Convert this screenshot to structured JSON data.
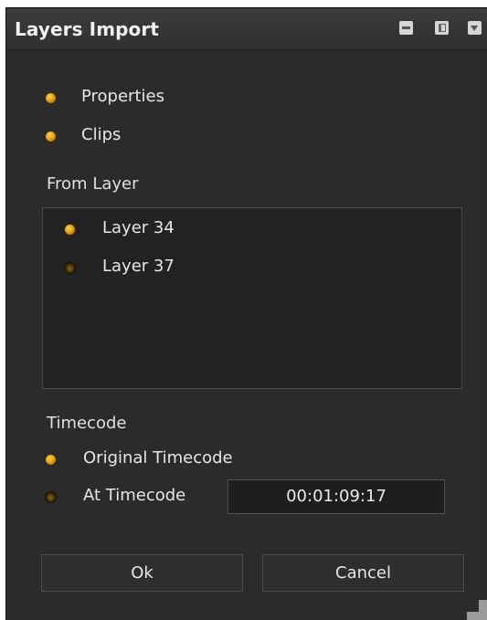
{
  "window": {
    "title": "Layers Import"
  },
  "import_options": [
    {
      "label": "Properties",
      "selected": true
    },
    {
      "label": "Clips",
      "selected": true
    }
  ],
  "from_layer": {
    "heading": "From Layer",
    "layers": [
      {
        "label": "Layer 34",
        "selected": true
      },
      {
        "label": "Layer 37",
        "selected": false
      }
    ]
  },
  "timecode": {
    "heading": "Timecode",
    "original_label": "Original Timecode",
    "original_selected": true,
    "at_label": "At Timecode",
    "at_selected": false,
    "value": "00:01:09:17"
  },
  "buttons": {
    "ok_label": "Ok",
    "cancel_label": "Cancel"
  },
  "colors": {
    "panel_bg": "#2b2b2b",
    "radio_on": "#e0a21a",
    "radio_off": "#3b2a08",
    "text": "#e6e6e6"
  },
  "icons": {
    "minimize": "minimize-icon",
    "maximize": "maximize-icon",
    "menu": "panel-menu-icon"
  }
}
